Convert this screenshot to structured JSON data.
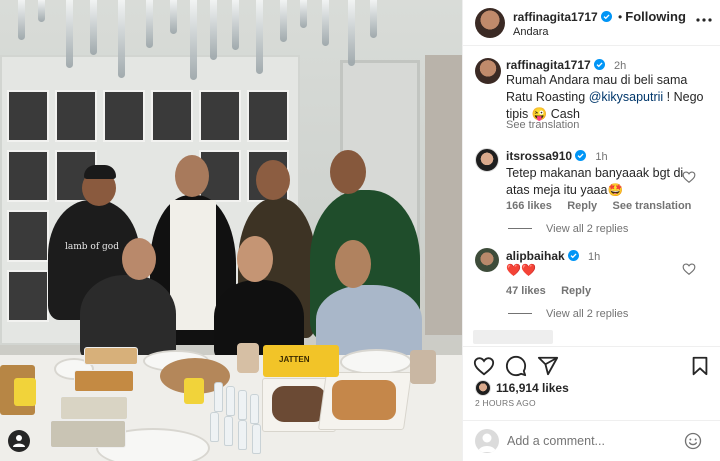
{
  "post": {
    "author": "raffinagita1717",
    "follow_state": "Following",
    "location": "Andara",
    "caption": {
      "username": "raffinagita1717",
      "time": "2h",
      "text_before": "Rumah Andara mau di beli sama Ratu Roasting ",
      "mention": "@kikysaputrii",
      "text_after": " ! Nego tipis 😜 Cash",
      "see_translation": "See translation"
    },
    "photo": {
      "tshirt_text": "lamb of god",
      "box_text": "JATTEN"
    }
  },
  "comments": [
    {
      "username": "itsrossa910",
      "time": "1h",
      "text": "Tetep makanan banyaaak bgt di atas meja itu yaaa🤩",
      "likes": "166 likes",
      "reply": "Reply",
      "see_translation": "See translation",
      "view_replies": "View all 2 replies"
    },
    {
      "username": "alipbaihak",
      "time": "1h",
      "text": "❤️❤️",
      "likes": "47 likes",
      "reply": "Reply",
      "view_replies": "View all 2 replies"
    }
  ],
  "stats": {
    "likes": "116,914 likes",
    "posted": "2 HOURS AGO"
  },
  "composer": {
    "placeholder": "Add a comment..."
  },
  "icons": {
    "more": "more-icon",
    "like": "heart-icon",
    "comment": "comment-icon",
    "share": "share-icon",
    "save": "bookmark-icon",
    "emoji": "emoji-icon",
    "verified": "verified-badge-icon",
    "tag": "user-tag-icon"
  },
  "colors": {
    "verified": "#0095f6",
    "link": "#00376b",
    "heart": "#ed4956",
    "muted": "#737373"
  }
}
